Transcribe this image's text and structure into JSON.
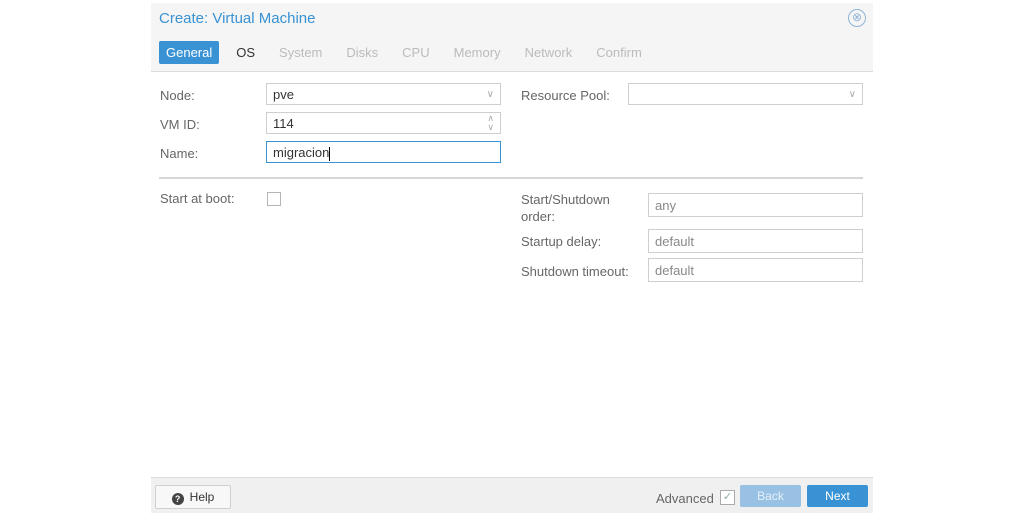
{
  "dialog": {
    "title": "Create: Virtual Machine",
    "close_icon": "⊗"
  },
  "tabs": [
    {
      "label": "General",
      "state": "active"
    },
    {
      "label": "OS",
      "state": "enabled"
    },
    {
      "label": "System",
      "state": "disabled"
    },
    {
      "label": "Disks",
      "state": "disabled"
    },
    {
      "label": "CPU",
      "state": "disabled"
    },
    {
      "label": "Memory",
      "state": "disabled"
    },
    {
      "label": "Network",
      "state": "disabled"
    },
    {
      "label": "Confirm",
      "state": "disabled"
    }
  ],
  "form": {
    "node": {
      "label": "Node:",
      "value": "pve"
    },
    "vmid": {
      "label": "VM ID:",
      "value": "114"
    },
    "name": {
      "label": "Name:",
      "value": "migracion"
    },
    "resource_pool": {
      "label": "Resource Pool:",
      "value": ""
    },
    "start_at_boot": {
      "label": "Start at boot:",
      "checked": false
    },
    "start_shutdown_order": {
      "label": "Start/Shutdown order:",
      "value": "any"
    },
    "startup_delay": {
      "label": "Startup delay:",
      "value": "default"
    },
    "shutdown_timeout": {
      "label": "Shutdown timeout:",
      "value": "default"
    }
  },
  "footer": {
    "help_label": "Help",
    "advanced_label": "Advanced",
    "advanced_checked": true,
    "back_label": "Back",
    "next_label": "Next"
  }
}
